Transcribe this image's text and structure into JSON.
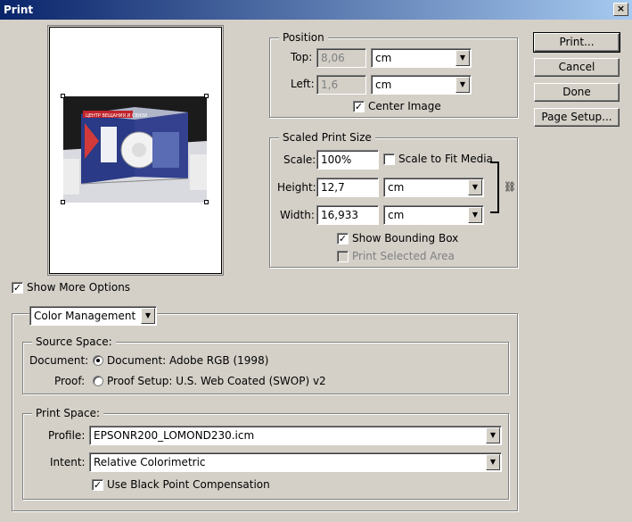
{
  "window": {
    "title": "Print",
    "close_label": "×"
  },
  "buttons": {
    "print": "Print...",
    "cancel": "Cancel",
    "done": "Done",
    "page_setup": "Page Setup..."
  },
  "position": {
    "label": "Position",
    "top_label": "Top:",
    "top_value": "8,06",
    "top_unit": "cm",
    "left_label": "Left:",
    "left_value": "1,6",
    "left_unit": "cm",
    "center_label": "Center Image",
    "center_checked": true
  },
  "scaled": {
    "label": "Scaled Print Size",
    "scale_label": "Scale:",
    "scale_value": "100%",
    "fit_label": "Scale to Fit Media",
    "height_label": "Height:",
    "height_value": "12,7",
    "height_unit": "cm",
    "width_label": "Width:",
    "width_value": "16,933",
    "width_unit": "cm",
    "bounding_label": "Show Bounding Box",
    "selected_label": "Print Selected Area"
  },
  "more": {
    "label": "Show More Options"
  },
  "color": {
    "dropdown": "Color Management",
    "source_label": "Source Space:",
    "document_label": "Document:",
    "document_option": "Document:  Adobe RGB (1998)",
    "proof_label": "Proof:",
    "proof_option": "Proof Setup:  U.S. Web Coated (SWOP) v2",
    "print_space_label": "Print Space:",
    "profile_label": "Profile:",
    "profile_value": "EPSONR200_LOMOND230.icm",
    "intent_label": "Intent:",
    "intent_value": "Relative Colorimetric",
    "bpc_label": "Use Black Point Compensation"
  },
  "preview": {
    "banner_text": "ЦЕНТР ВЕЩАНИЯ И СВЯЗИ"
  }
}
